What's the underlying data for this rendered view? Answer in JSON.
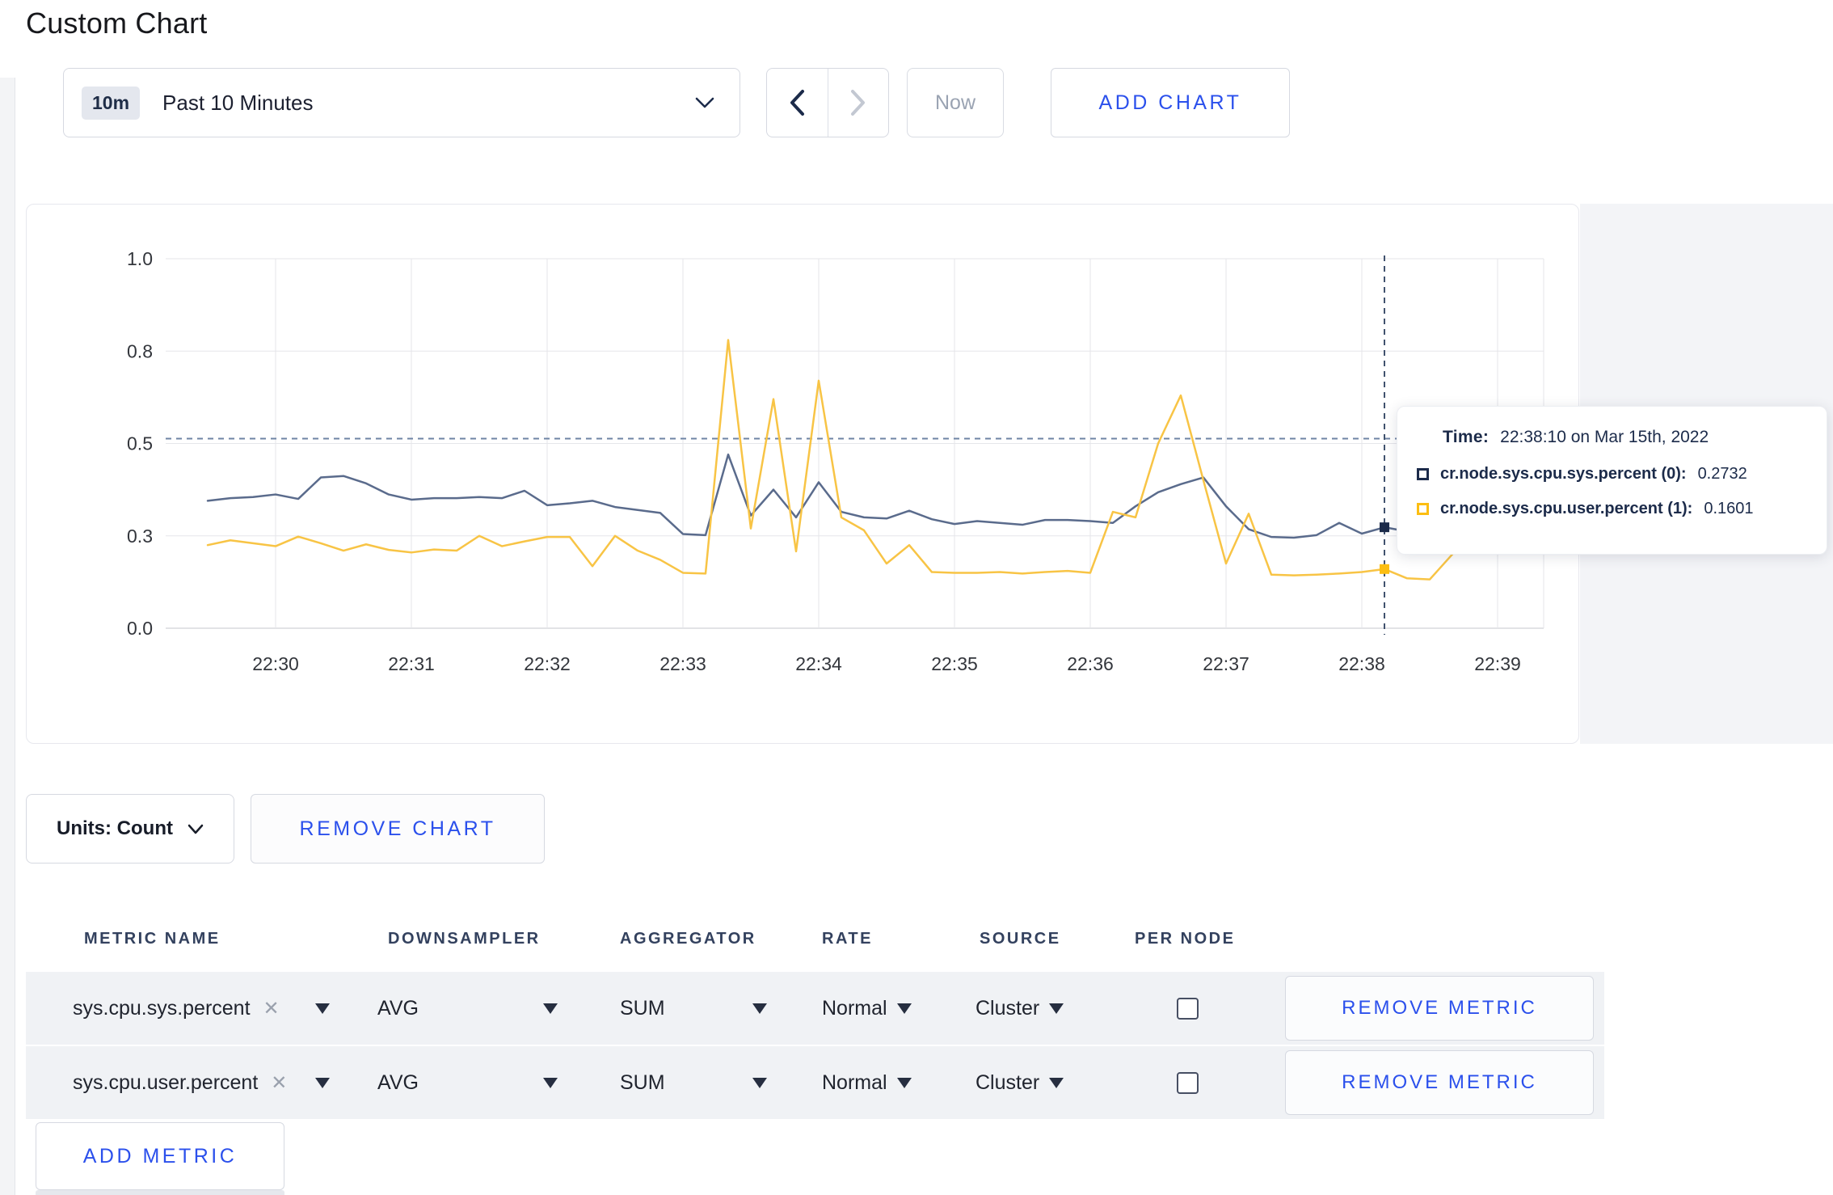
{
  "page": {
    "title": "Custom Chart"
  },
  "toolbar": {
    "time_badge": "10m",
    "time_range_label": "Past 10 Minutes",
    "now_label": "Now",
    "add_chart_label": "ADD CHART"
  },
  "chart_data": {
    "type": "line",
    "title": "",
    "x_start": "22:29:30",
    "x_interval_seconds": 10,
    "x_ticks": [
      "22:30",
      "22:31",
      "22:32",
      "22:33",
      "22:34",
      "22:35",
      "22:36",
      "22:37",
      "22:38",
      "22:39"
    ],
    "y_ticks": [
      {
        "value": 0.0,
        "label": "0.0"
      },
      {
        "value": 0.25,
        "label": "0.3"
      },
      {
        "value": 0.5,
        "label": "0.5"
      },
      {
        "value": 0.75,
        "label": "0.8"
      },
      {
        "value": 1.0,
        "label": "1.0"
      }
    ],
    "ylim": [
      0,
      1
    ],
    "grid": true,
    "legend_position": "none",
    "series": [
      {
        "name": "cr.node.sys.cpu.sys.percent",
        "line_color": "#5a6b8c",
        "swatch_color": "#1c2b4a",
        "values": [
          0.345,
          0.352,
          0.355,
          0.362,
          0.35,
          0.408,
          0.412,
          0.392,
          0.362,
          0.348,
          0.352,
          0.352,
          0.355,
          0.352,
          0.372,
          0.333,
          0.338,
          0.345,
          0.328,
          0.32,
          0.312,
          0.255,
          0.252,
          0.47,
          0.305,
          0.375,
          0.3,
          0.395,
          0.315,
          0.3,
          0.297,
          0.318,
          0.295,
          0.282,
          0.29,
          0.285,
          0.28,
          0.293,
          0.293,
          0.29,
          0.285,
          0.33,
          0.368,
          0.39,
          0.408,
          0.33,
          0.268,
          0.247,
          0.245,
          0.252,
          0.285,
          0.256,
          0.2732,
          0.262,
          0.255,
          0.262,
          0.285,
          0.268,
          0.262,
          0.3
        ]
      },
      {
        "name": "cr.node.sys.cpu.user.percent",
        "line_color": "#f8c445",
        "swatch_color": "#fcbe12",
        "values": [
          0.225,
          0.238,
          0.23,
          0.222,
          0.248,
          0.23,
          0.21,
          0.227,
          0.212,
          0.205,
          0.213,
          0.21,
          0.25,
          0.222,
          0.235,
          0.247,
          0.247,
          0.168,
          0.25,
          0.21,
          0.185,
          0.15,
          0.148,
          0.78,
          0.27,
          0.62,
          0.208,
          0.67,
          0.3,
          0.265,
          0.175,
          0.225,
          0.152,
          0.15,
          0.15,
          0.152,
          0.148,
          0.152,
          0.155,
          0.15,
          0.315,
          0.3,
          0.5,
          0.63,
          0.4,
          0.175,
          0.31,
          0.145,
          0.143,
          0.145,
          0.148,
          0.152,
          0.1601,
          0.135,
          0.132,
          0.2,
          0.35,
          0.28,
          0.22,
          0.28
        ]
      }
    ],
    "crosshair": {
      "x_index": 52,
      "y_value": 0.513
    }
  },
  "tooltip": {
    "time_label": "Time:",
    "time_value": "22:38:10 on Mar 15th, 2022",
    "rows": [
      {
        "name": "cr.node.sys.cpu.sys.percent (0):",
        "value": "0.2732",
        "swatch_color": "#1c2b4a"
      },
      {
        "name": "cr.node.sys.cpu.user.percent (1):",
        "value": "0.1601",
        "swatch_color": "#fcbe12"
      }
    ]
  },
  "chart_footer": {
    "units_label": "Units: Count",
    "remove_chart_label": "REMOVE CHART"
  },
  "metrics_table": {
    "headers": [
      "METRIC NAME",
      "DOWNSAMPLER",
      "AGGREGATOR",
      "RATE",
      "SOURCE",
      "PER NODE"
    ],
    "rows": [
      {
        "name": "sys.cpu.sys.percent",
        "downsampler": "AVG",
        "aggregator": "SUM",
        "rate": "Normal",
        "source": "Cluster",
        "per_node": false,
        "remove_label": "REMOVE METRIC"
      },
      {
        "name": "sys.cpu.user.percent",
        "downsampler": "AVG",
        "aggregator": "SUM",
        "rate": "Normal",
        "source": "Cluster",
        "per_node": false,
        "remove_label": "REMOVE METRIC"
      }
    ],
    "add_metric_label": "ADD METRIC"
  },
  "colors": {
    "accent_blue": "#2b50ec",
    "navy": "#1c2b4a",
    "grid": "#e5e6ea",
    "axis_line": "#d8dade",
    "crosshair": "#6f84a5",
    "row_gray": "#f0f2f5"
  }
}
